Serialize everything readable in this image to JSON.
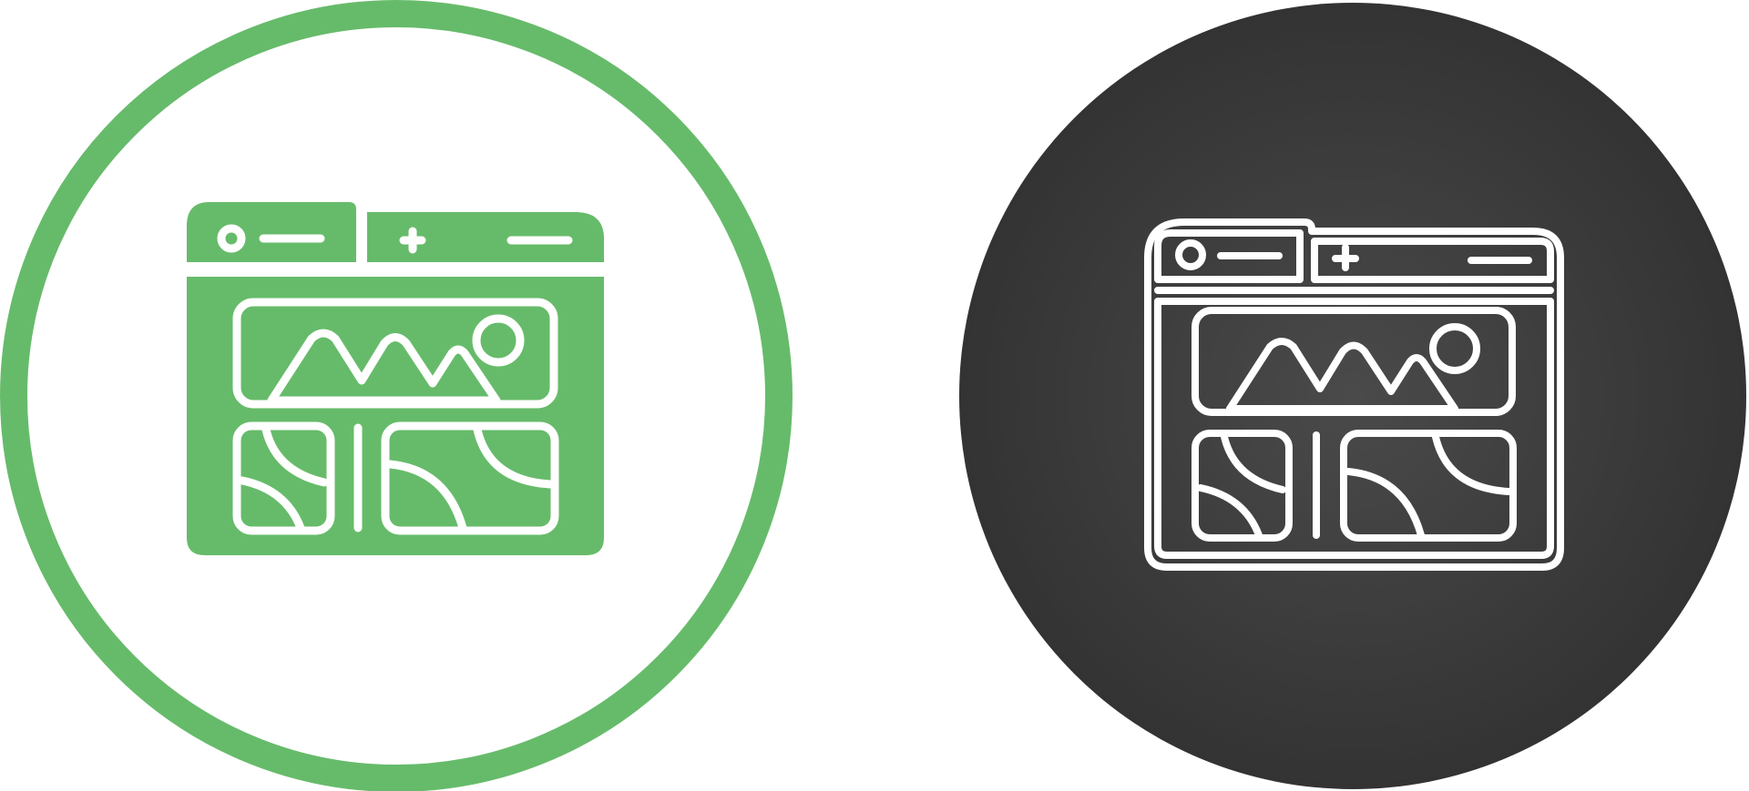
{
  "icons": [
    {
      "name": "web-gallery-icon",
      "variant": "glyph",
      "accent_color": "#66bb6a",
      "background_color": "#ffffff",
      "ring_color": "#66bb6a",
      "line_color": "#ffffff"
    },
    {
      "name": "web-gallery-icon",
      "variant": "outline",
      "background_color": "#3d3d3d",
      "line_color": "#ffffff"
    }
  ]
}
